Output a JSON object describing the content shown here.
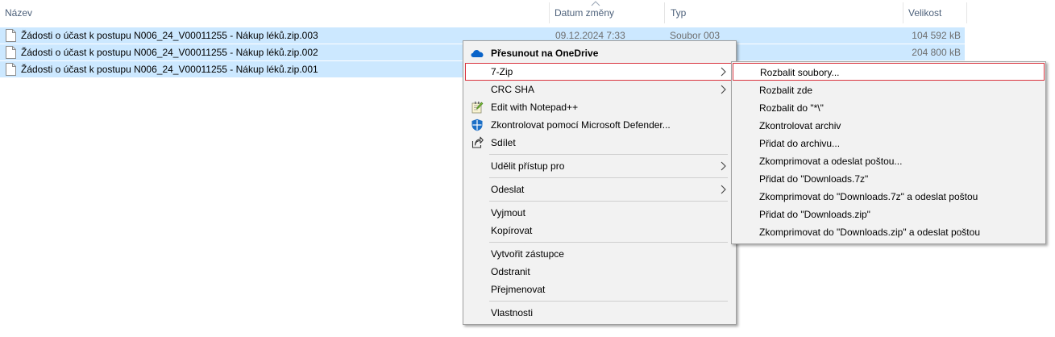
{
  "columns": {
    "name": "Název",
    "date": "Datum změny",
    "type": "Typ",
    "size": "Velikost"
  },
  "files": [
    {
      "name": "Žádosti o účast k postupu N006_24_V00011255 - Nákup léků.zip.003",
      "date": "09.12.2024 7:33",
      "type": "Soubor 003",
      "size": "104 592 kB"
    },
    {
      "name": "Žádosti o účast k postupu N006_24_V00011255 - Nákup léků.zip.002",
      "date": "",
      "type": "",
      "size": "204 800 kB"
    },
    {
      "name": "Žádosti o účast k postupu N006_24_V00011255 - Nákup léků.zip.001",
      "date": "",
      "type": "",
      "size": ""
    }
  ],
  "context_menu": {
    "onedrive": "Přesunout na OneDrive",
    "sevenzip": "7-Zip",
    "crcsha": "CRC SHA",
    "notepad": "Edit with Notepad++",
    "defender": "Zkontrolovat pomocí Microsoft Defender...",
    "share": "Sdílet",
    "grant_access": "Udělit přístup pro",
    "send_to": "Odeslat",
    "cut": "Vyjmout",
    "copy": "Kopírovat",
    "shortcut": "Vytvořit zástupce",
    "delete": "Odstranit",
    "rename": "Přejmenovat",
    "properties": "Vlastnosti"
  },
  "submenu_7zip": [
    "Rozbalit soubory...",
    "Rozbalit zde",
    "Rozbalit do \"*\\\"",
    "Zkontrolovat archiv",
    "Přidat do archivu...",
    "Zkomprimovat a odeslat poštou...",
    "Přidat do \"Downloads.7z\"",
    "Zkomprimovat do \"Downloads.7z\" a odeslat poštou",
    "Přidat do \"Downloads.zip\"",
    "Zkomprimovat do \"Downloads.zip\" a odeslat poštou"
  ],
  "colors": {
    "selection": "#cce8ff",
    "menu_bg": "#f2f2f2",
    "highlight_border_red": "#d9333f",
    "header_text": "#4c607a"
  }
}
